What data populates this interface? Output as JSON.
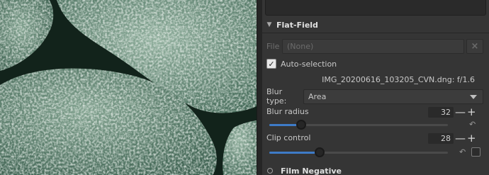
{
  "flat_field": {
    "title": "Flat-Field",
    "file_label": "File",
    "file_value": "(None)",
    "clear_icon": "×",
    "auto_selection_label": "Auto-selection",
    "auto_selection_checked": true,
    "selected_file": "IMG_20200616_103205_CVN.dng: f/1.6",
    "blur_type_label": "Blur type:",
    "blur_type_value": "Area",
    "blur_radius_label": "Blur radius",
    "blur_radius_value": "32",
    "blur_radius_fraction": 0.18,
    "clip_control_label": "Clip control",
    "clip_control_value": "28",
    "clip_control_fraction": 0.28,
    "minus_glyph": "—",
    "plus_glyph": "+"
  },
  "next_section": {
    "title": "Film Negative"
  },
  "colors": {
    "accent": "#3e7bc7",
    "panel_bg": "#353535"
  }
}
